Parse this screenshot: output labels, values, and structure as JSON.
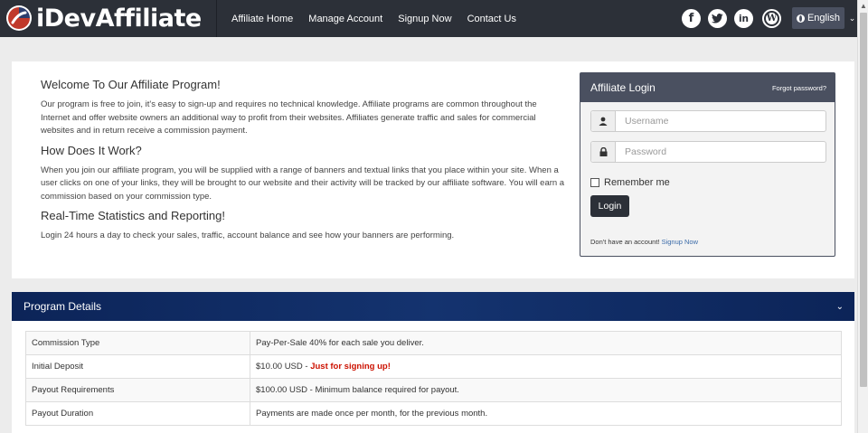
{
  "brand": {
    "name": "iDevAffiliate"
  },
  "nav": {
    "links": [
      "Affiliate Home",
      "Manage Account",
      "Signup Now",
      "Contact Us"
    ],
    "social": [
      "facebook-icon",
      "twitter-icon",
      "linkedin-icon",
      "wordpress-icon"
    ],
    "language": "English"
  },
  "welcome": {
    "heading1": "Welcome To Our Affiliate Program!",
    "para1": "Our program is free to join, it's easy to sign-up and requires no technical knowledge. Affiliate programs are common throughout the Internet and offer website owners an additional way to profit from their websites. Affiliates generate traffic and sales for commercial websites and in return receive a commission payment.",
    "heading2": "How Does It Work?",
    "para2": "When you join our affiliate program, you will be supplied with a range of banners and textual links that you place within your site. When a user clicks on one of your links, they will be brought to our website and their activity will be tracked by our affiliate software. You will earn a commission based on your commission type.",
    "heading3": "Real-Time Statistics and Reporting!",
    "para3": "Login 24 hours a day to check your sales, traffic, account balance and see how your banners are performing."
  },
  "login": {
    "title": "Affiliate Login",
    "forgot": "Forgot password?",
    "username_placeholder": "Username",
    "password_placeholder": "Password",
    "remember": "Remember me",
    "button": "Login",
    "no_account": "Don't have an account!",
    "signup": "Signup Now"
  },
  "program": {
    "title": "Program Details",
    "rows": [
      {
        "label": "Commission Type",
        "value": "Pay-Per-Sale 40% for each sale you deliver.",
        "highlight": ""
      },
      {
        "label": "Initial Deposit",
        "value": "$10.00 USD - ",
        "highlight": "Just for signing up!"
      },
      {
        "label": "Payout Requirements",
        "value": "$100.00 USD - Minimum balance required for payout.",
        "highlight": ""
      },
      {
        "label": "Payout Duration",
        "value": "Payments are made once per month, for the previous month.",
        "highlight": ""
      }
    ]
  },
  "colors": {
    "navbar": "#2c3038",
    "login_header": "#4a5060",
    "program_header": "#0c2458",
    "highlight": "#cc1100",
    "link": "#3a6aa8"
  }
}
